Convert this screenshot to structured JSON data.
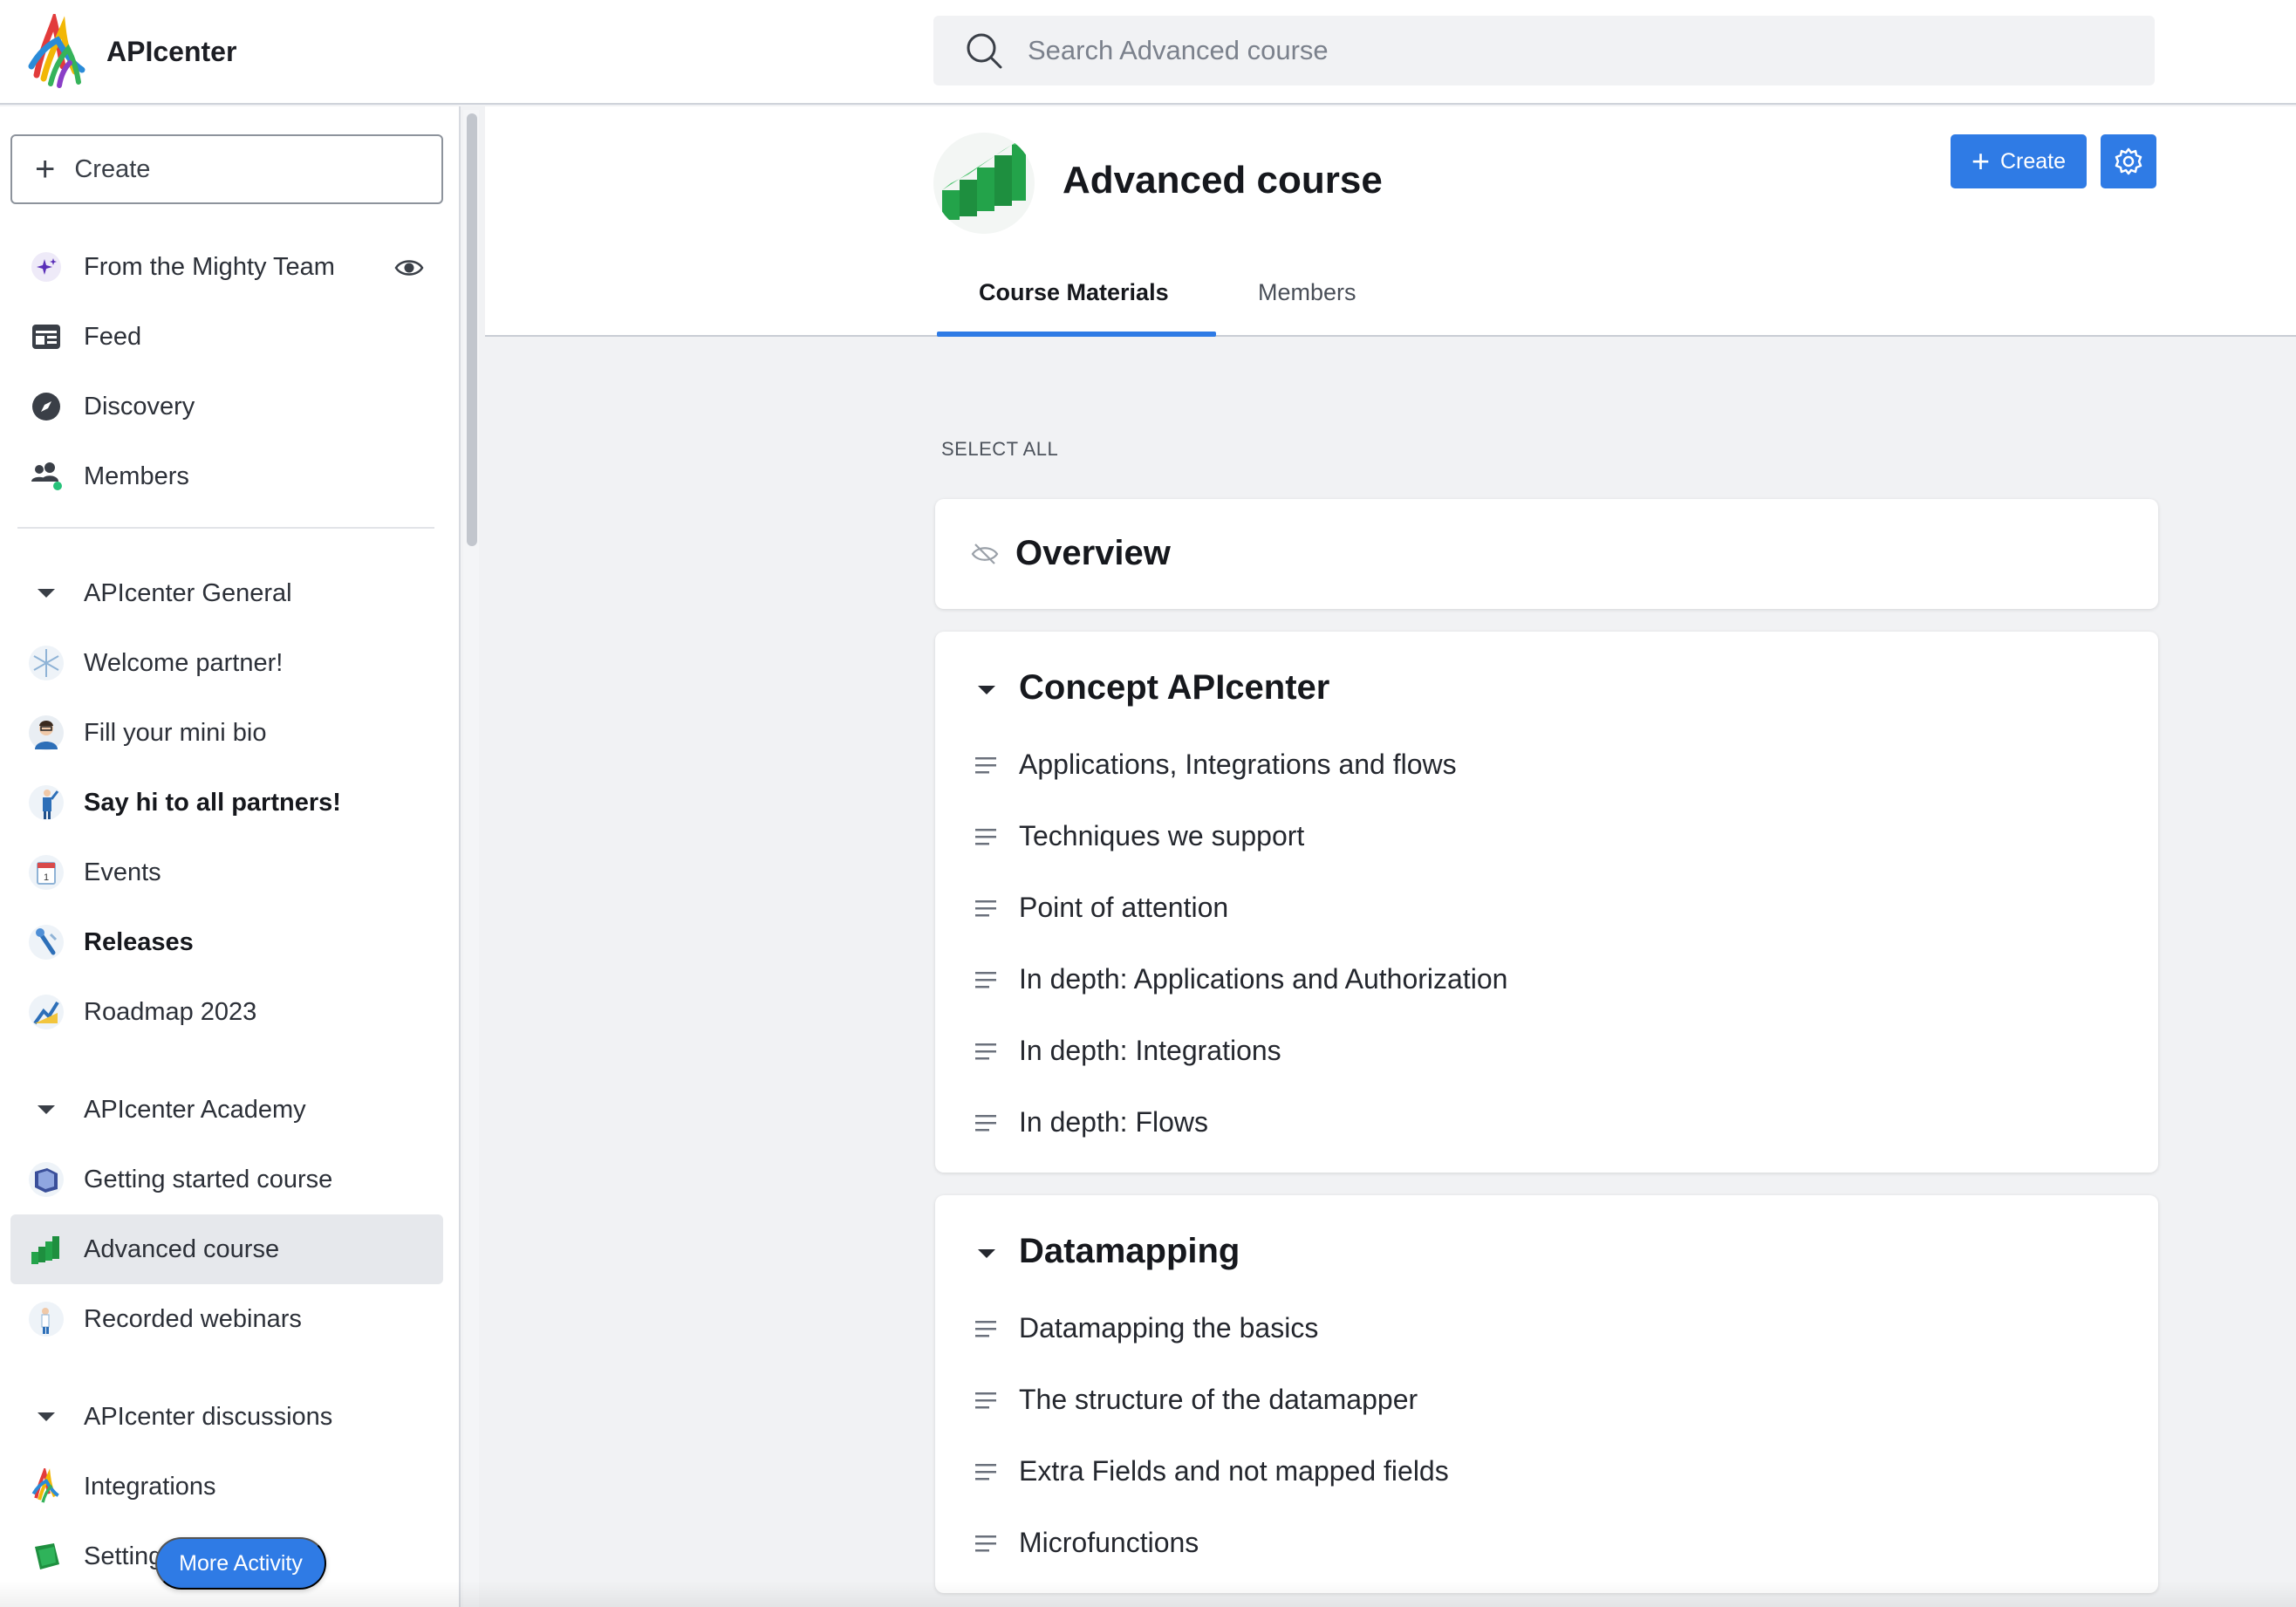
{
  "app": {
    "name": "APIcenter"
  },
  "search": {
    "placeholder": "Search Advanced course"
  },
  "sidebar": {
    "create_label": "Create",
    "top_items": [
      {
        "label": "From the Mighty Team",
        "icon": "sparkle-icon"
      },
      {
        "label": "Feed",
        "icon": "feed-icon"
      },
      {
        "label": "Discovery",
        "icon": "compass-icon"
      },
      {
        "label": "Members",
        "icon": "members-icon"
      }
    ],
    "sections": [
      {
        "title": "APIcenter General",
        "items": [
          {
            "label": "Welcome partner!"
          },
          {
            "label": "Fill your mini bio"
          },
          {
            "label": "Say hi to all partners!"
          },
          {
            "label": "Events"
          },
          {
            "label": "Releases"
          },
          {
            "label": "Roadmap 2023"
          }
        ]
      },
      {
        "title": "APIcenter Academy",
        "items": [
          {
            "label": "Getting started course"
          },
          {
            "label": "Advanced course"
          },
          {
            "label": "Recorded webinars"
          }
        ]
      },
      {
        "title": "APIcenter discussions",
        "items": [
          {
            "label": "Integrations"
          },
          {
            "label": "Setting"
          }
        ]
      }
    ],
    "more_activity": "More Activity"
  },
  "course": {
    "title": "Advanced course",
    "create_label": "Create",
    "tabs": [
      {
        "label": "Course Materials",
        "active": true
      },
      {
        "label": "Members",
        "active": false
      }
    ],
    "select_all": "SELECT ALL",
    "sections": [
      {
        "title": "Overview",
        "lessons": []
      },
      {
        "title": "Concept APIcenter",
        "lessons": [
          "Applications, Integrations and flows",
          "Techniques we support",
          "Point of attention",
          "In depth: Applications and Authorization",
          "In depth: Integrations",
          "In depth: Flows"
        ]
      },
      {
        "title": "Datamapping",
        "lessons": [
          "Datamapping the basics",
          "The structure of the datamapper",
          "Extra Fields and not mapped fields",
          "Microfunctions"
        ]
      }
    ]
  },
  "colors": {
    "accent": "#2f7be5",
    "active_sidebar_bg": "#e6e8ec"
  }
}
